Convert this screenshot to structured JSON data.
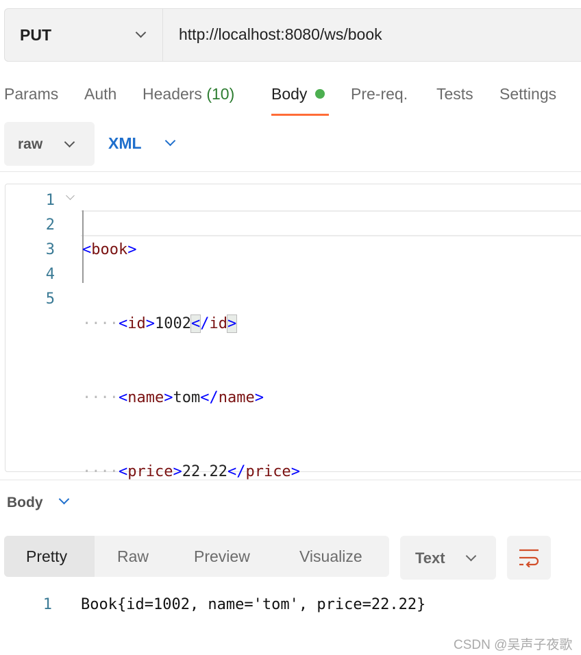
{
  "request": {
    "method": "PUT",
    "url": "http://localhost:8080/ws/book"
  },
  "tabs": [
    {
      "label": "Params"
    },
    {
      "label": "Auth"
    },
    {
      "label": "Headers",
      "count": "(10)"
    },
    {
      "label": "Body"
    },
    {
      "label": "Pre-req."
    },
    {
      "label": "Tests"
    },
    {
      "label": "Settings"
    }
  ],
  "body_options": {
    "mode": "raw",
    "language": "XML"
  },
  "editor": {
    "lines": [
      "1",
      "2",
      "3",
      "4",
      "5"
    ],
    "tags": {
      "book": "book",
      "id": "id",
      "name": "name",
      "price": "price"
    },
    "values": {
      "id": "1002",
      "name": "tom",
      "price": "22.22"
    }
  },
  "response": {
    "section_label": "Body",
    "view_tabs": [
      "Pretty",
      "Raw",
      "Preview",
      "Visualize"
    ],
    "format": "Text",
    "line_number": "1",
    "line": "Book{id=1002, name='tom', price=22.22}"
  },
  "watermark": "CSDN @吴声子夜歌",
  "colors": {
    "accent": "#ff6c37",
    "status_dot": "#4caf50",
    "headers_count": "#2e7d32",
    "language": "#1f6fcc"
  }
}
